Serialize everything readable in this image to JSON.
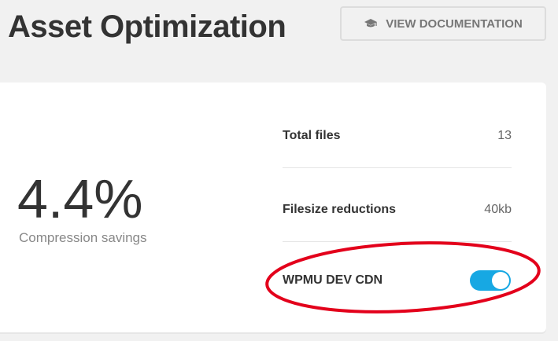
{
  "header": {
    "title": "Asset Optimization",
    "doc_button_label": "VIEW DOCUMENTATION",
    "doc_button_icon": "graduation-cap-icon"
  },
  "summary": {
    "value": "4.4%",
    "label": "Compression savings"
  },
  "stats": [
    {
      "label": "Total files",
      "value": "13"
    },
    {
      "label": "Filesize reductions",
      "value": "40kb"
    },
    {
      "label": "WPMU DEV CDN",
      "toggle_on": true
    }
  ],
  "colors": {
    "toggle_on": "#17a8e3",
    "annotation": "#e3001b"
  }
}
